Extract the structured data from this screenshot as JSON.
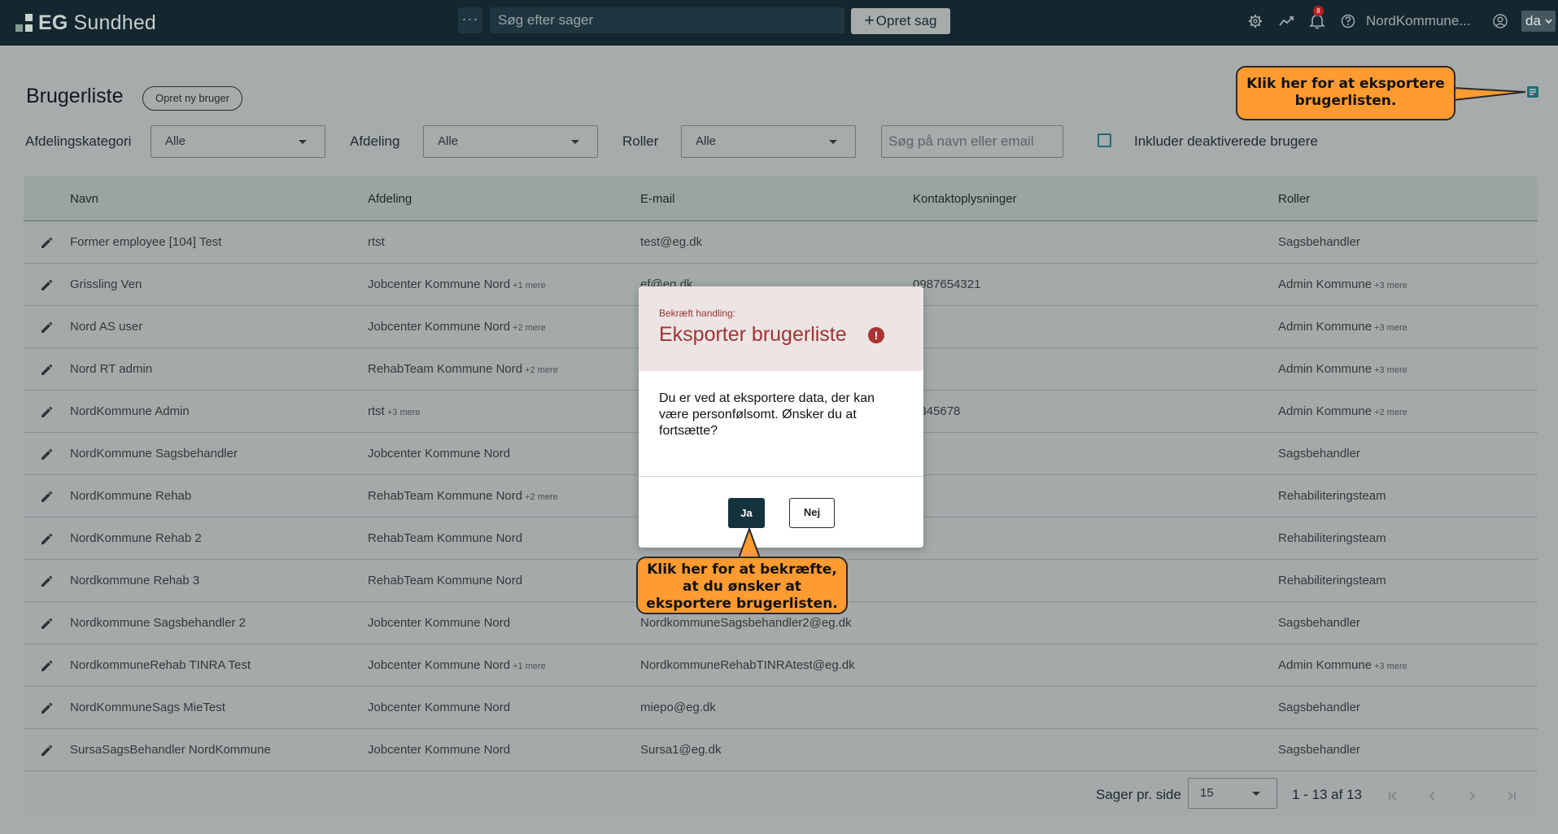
{
  "app": {
    "brand_bold": "EG",
    "brand_rest": "Sundhed",
    "more_label": "···",
    "search_placeholder": "Søg efter sager",
    "new_case_label": "Opret sag",
    "notification_count": "8",
    "org_name": "NordKommune...",
    "language": "da"
  },
  "page": {
    "title": "Brugerliste",
    "new_user_label": "Opret ny bruger"
  },
  "filters": {
    "dept_category_label": "Afdelingskategori",
    "dept_category_value": "Alle",
    "dept_label": "Afdeling",
    "dept_value": "Alle",
    "roles_label": "Roller",
    "roles_value": "Alle",
    "search_placeholder": "Søg på navn eller email",
    "include_inactive_label": "Inkluder deaktiverede brugere"
  },
  "table": {
    "columns": [
      "Navn",
      "Afdeling",
      "E-mail",
      "Kontaktoplysninger",
      "Roller"
    ],
    "rows": [
      {
        "name": "Former employee [104] Test",
        "dept": "rtst",
        "dept_more": "",
        "email": "test@eg.dk",
        "contact": "",
        "role": "Sagsbehandler",
        "role_more": ""
      },
      {
        "name": "Grissling Ven",
        "dept": "Jobcenter Kommune Nord",
        "dept_more": "+1 mere",
        "email": "ef@eg.dk",
        "contact": "0987654321",
        "role": "Admin Kommune",
        "role_more": "+3 mere"
      },
      {
        "name": "Nord AS user",
        "dept": "Jobcenter Kommune Nord",
        "dept_more": "+2 mere",
        "email": "",
        "contact": "",
        "role": "Admin Kommune",
        "role_more": "+3 mere"
      },
      {
        "name": "Nord RT admin",
        "dept": "RehabTeam Kommune Nord",
        "dept_more": "+2 mere",
        "email": "",
        "contact": "",
        "role": "Admin Kommune",
        "role_more": "+3 mere"
      },
      {
        "name": "NordKommune Admin",
        "dept": "rtst",
        "dept_more": "+3 mere",
        "email": "",
        "contact": "2345678",
        "role": "Admin Kommune",
        "role_more": "+2 mere"
      },
      {
        "name": "NordKommune Sagsbehandler",
        "dept": "Jobcenter Kommune Nord",
        "dept_more": "",
        "email": "",
        "contact": "",
        "role": "Sagsbehandler",
        "role_more": ""
      },
      {
        "name": "NordKommune Rehab",
        "dept": "RehabTeam Kommune Nord",
        "dept_more": "+2 mere",
        "email": "",
        "contact": "",
        "role": "Rehabiliteringsteam",
        "role_more": ""
      },
      {
        "name": "NordKommune Rehab 2",
        "dept": "RehabTeam Kommune Nord",
        "dept_more": "",
        "email": "",
        "contact": "",
        "role": "Rehabiliteringsteam",
        "role_more": ""
      },
      {
        "name": "Nordkommune Rehab 3",
        "dept": "RehabTeam Kommune Nord",
        "dept_more": "",
        "email": "",
        "contact": "",
        "role": "Rehabiliteringsteam",
        "role_more": ""
      },
      {
        "name": "Nordkommune Sagsbehandler 2",
        "dept": "Jobcenter Kommune Nord",
        "dept_more": "",
        "email": "NordkommuneSagsbehandler2@eg.dk",
        "contact": "",
        "role": "Sagsbehandler",
        "role_more": ""
      },
      {
        "name": "NordkommuneRehab TINRA Test",
        "dept": "Jobcenter Kommune Nord",
        "dept_more": "+1 mere",
        "email": "NordkommuneRehabTINRAtest@eg.dk",
        "contact": "",
        "role": "Admin Kommune",
        "role_more": "+3 mere"
      },
      {
        "name": "NordKommuneSags MieTest",
        "dept": "Jobcenter Kommune Nord",
        "dept_more": "",
        "email": "miepo@eg.dk",
        "contact": "",
        "role": "Sagsbehandler",
        "role_more": ""
      },
      {
        "name": "SursaSagsBehandler NordKommune",
        "dept": "Jobcenter Kommune Nord",
        "dept_more": "",
        "email": "Sursa1@eg.dk",
        "contact": "",
        "role": "Sagsbehandler",
        "role_more": ""
      }
    ]
  },
  "pagination": {
    "per_page_label": "Sager pr. side",
    "per_page_value": "15",
    "range_text": "1 - 13 af 13"
  },
  "modal": {
    "subtitle": "Bekræft handling:",
    "title": "Eksporter brugerliste",
    "body": "Du er ved at eksportere data, der kan være personfølsomt. Ønsker du at fortsætte?",
    "yes_label": "Ja",
    "no_label": "Nej"
  },
  "callouts": {
    "export": "Klik her for at eksportere brugerlisten.",
    "confirm": "Klik her for at bekræfte, at du ønsker at eksportere brugerlisten."
  },
  "colors": {
    "topbar": "#14262f",
    "accent_teal": "#1e6e73",
    "modal_title": "#a03535",
    "callout": "#ff9b30"
  }
}
